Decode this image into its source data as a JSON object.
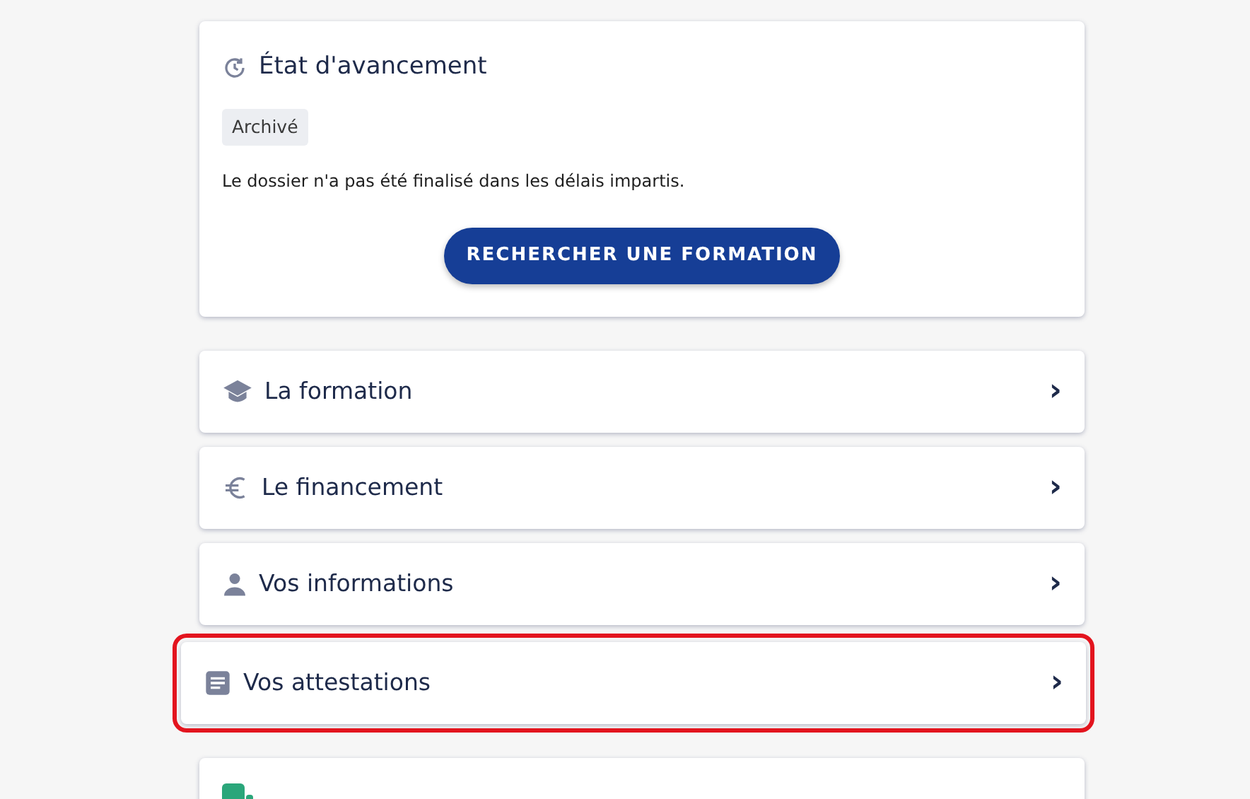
{
  "status_card": {
    "title": "État d'avancement",
    "badge": "Archivé",
    "message": "Le dossier n'a pas été finalisé dans les délais impartis.",
    "button": "RECHERCHER UNE FORMATION"
  },
  "sections": [
    {
      "kind": "graduation",
      "label": "La formation",
      "chevron": "›",
      "highlighted": false
    },
    {
      "kind": "euro",
      "label": "Le financement",
      "chevron": "›",
      "highlighted": false
    },
    {
      "kind": "person",
      "label": "Vos informations",
      "chevron": "›",
      "highlighted": false
    },
    {
      "kind": "document",
      "label": "Vos attestations",
      "chevron": "›",
      "highlighted": true
    }
  ],
  "bottom_card": {
    "kind": "partial"
  }
}
